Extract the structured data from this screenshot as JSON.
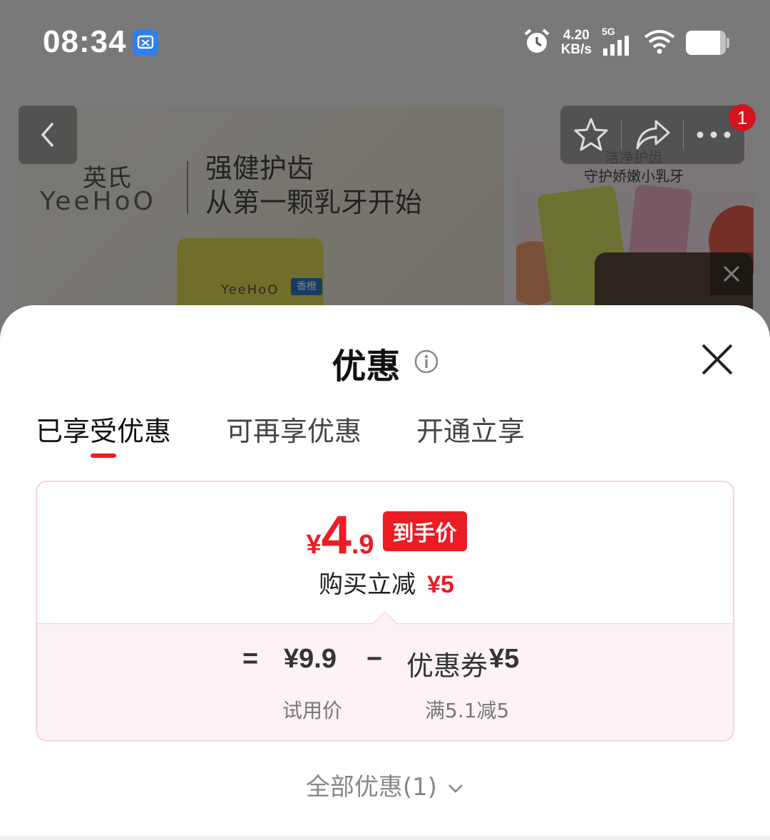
{
  "status_bar": {
    "time": "08:34",
    "net_speed_value": "4.20",
    "net_speed_unit": "KB/s",
    "signal_label": "5G",
    "battery_level": 0.85,
    "icons": [
      "screenshot-app-icon",
      "alarm-icon",
      "signal-icon",
      "wifi-icon",
      "battery-icon"
    ]
  },
  "background": {
    "brand_cn": "英氏",
    "brand_en": "YeeHoO",
    "slogan_line1": "强健护齿",
    "slogan_line2": "从第一颗乳牙开始",
    "tube_brand": "YeeHoO",
    "tube_tag": "香橙",
    "side_line1": "洁净护齿",
    "side_line2": "守护娇嫩小乳牙",
    "notification_count": "1"
  },
  "sheet": {
    "title": "优惠",
    "tabs": [
      {
        "label": "已享受优惠",
        "active": true
      },
      {
        "label": "可再享优惠",
        "active": false
      },
      {
        "label": "开通立享",
        "active": false
      }
    ],
    "final_price": {
      "currency": "¥",
      "integer": "4",
      "decimal": ".9",
      "tag": "到手价"
    },
    "reduce": {
      "label": "购买立减",
      "amount": "¥5"
    },
    "breakdown": {
      "equals": "=",
      "trial_price": "¥9.9",
      "minus": "−",
      "coupon_label": "优惠券",
      "coupon_amount": "¥5",
      "trial_label": "试用价",
      "coupon_condition": "满5.1减5"
    },
    "all_offers": "全部优惠(1)"
  },
  "colors": {
    "accent": "#ec1c24",
    "card_border": "#f7d4dc",
    "card_fill": "#fdf2f5"
  }
}
